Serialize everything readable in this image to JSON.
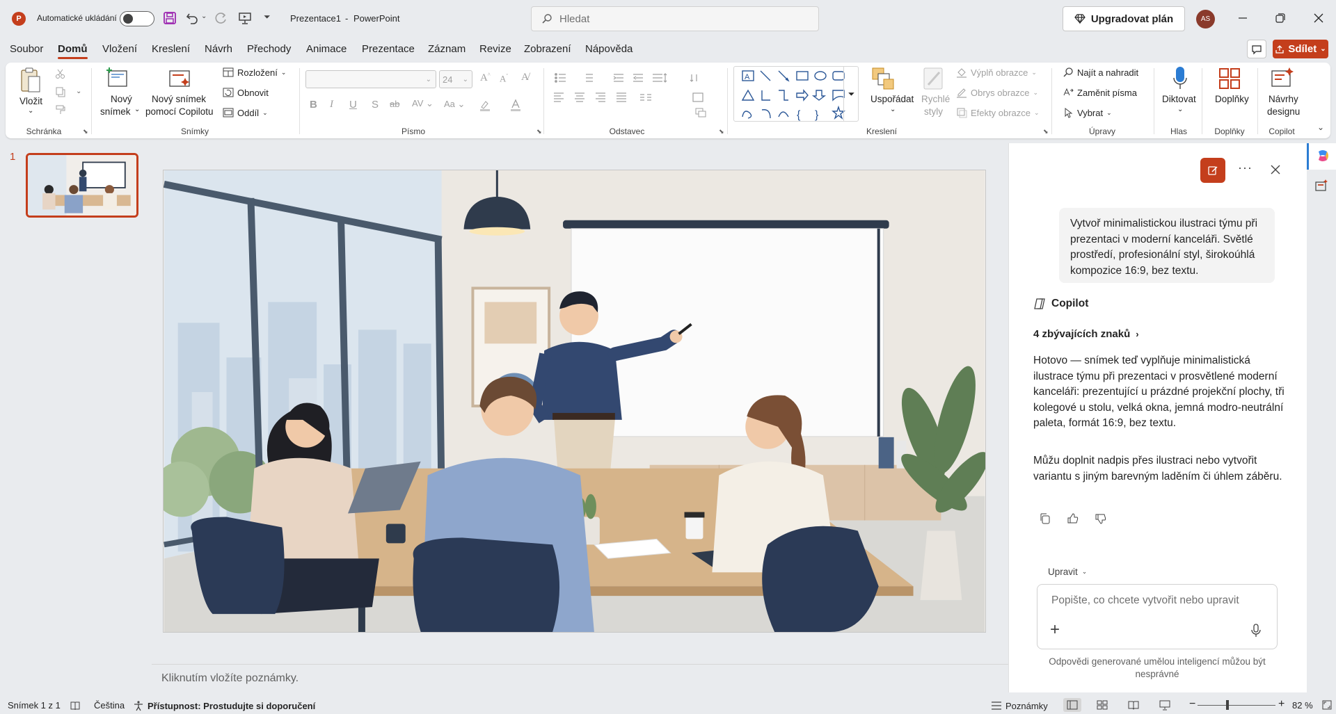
{
  "app": {
    "autosave_label": "Automatické ukládání",
    "doc_title": "Prezentace1",
    "title_sep": "-",
    "app_name": "PowerPoint",
    "search_placeholder": "Hledat",
    "upgrade_label": "Upgradovat plán",
    "avatar_initials": "AS",
    "accent": "#c43e1c"
  },
  "menu": {
    "items": [
      "Soubor",
      "Domů",
      "Vložení",
      "Kreslení",
      "Návrh",
      "Přechody",
      "Animace",
      "Prezentace",
      "Záznam",
      "Revize",
      "Zobrazení",
      "Nápověda"
    ],
    "active": "Domů",
    "share_label": "Sdílet"
  },
  "ribbon": {
    "clipboard": {
      "paste": "Vložit",
      "group": "Schránka"
    },
    "slides": {
      "new_slide_1": "Nový",
      "new_slide_2": "snímek",
      "copilot_slide_1": "Nový snímek",
      "copilot_slide_2": "pomocí Copilotu",
      "layout": "Rozložení",
      "reset": "Obnovit",
      "section": "Oddíl",
      "group": "Snímky"
    },
    "font": {
      "size": "24",
      "group": "Písmo"
    },
    "paragraph": {
      "group": "Odstavec"
    },
    "drawing": {
      "arrange": "Uspořádat",
      "quick_styles_1": "Rychlé",
      "quick_styles_2": "styly",
      "fill": "Výplň obrazce",
      "outline": "Obrys obrazce",
      "effects": "Efekty obrazce",
      "group": "Kreslení"
    },
    "editing": {
      "find": "Najít a nahradit",
      "replace_fonts": "Zaměnit písma",
      "select": "Vybrat",
      "group": "Úpravy"
    },
    "voice": {
      "dictate": "Diktovat",
      "group": "Hlas"
    },
    "addins": {
      "label": "Doplňky",
      "group": "Doplňky"
    },
    "designer": {
      "label_1": "Návrhy",
      "label_2": "designu",
      "group": "Copilot"
    }
  },
  "thumbs": {
    "number": "1"
  },
  "notes": {
    "placeholder": "Kliknutím vložíte poznámky."
  },
  "copilot": {
    "user_message": "Vytvoř minimalistickou ilustraci týmu při prezentaci v moderní kanceláři. Světlé prostředí, profesionální styl, širokoúhlá kompozice 16:9, bez textu.",
    "name": "Copilot",
    "remaining": "4 zbývajících znaků",
    "answer_1": "Hotovo — snímek teď vyplňuje minimalistická ilustrace týmu při prezentaci v prosvětlené moderní kanceláři: prezentující u prázdné projekční plochy, tři kolegové u stolu, velká okna, jemná modro-neutrální paleta, formát 16:9, bez textu.",
    "answer_2": "Můžu doplnit nadpis přes ilustraci nebo vytvořit variantu s jiným barevným laděním či úhlem záběru.",
    "mode": "Upravit",
    "input_placeholder": "Popište, co chcete vytvořit nebo upravit",
    "disclaimer": "Odpovědi generované umělou inteligencí můžou být nesprávné"
  },
  "status": {
    "slide": "Snímek 1 z 1",
    "language": "Čeština",
    "accessibility": "Přístupnost: Prostudujte si doporučení",
    "notes": "Poznámky",
    "zoom": "82 %"
  }
}
